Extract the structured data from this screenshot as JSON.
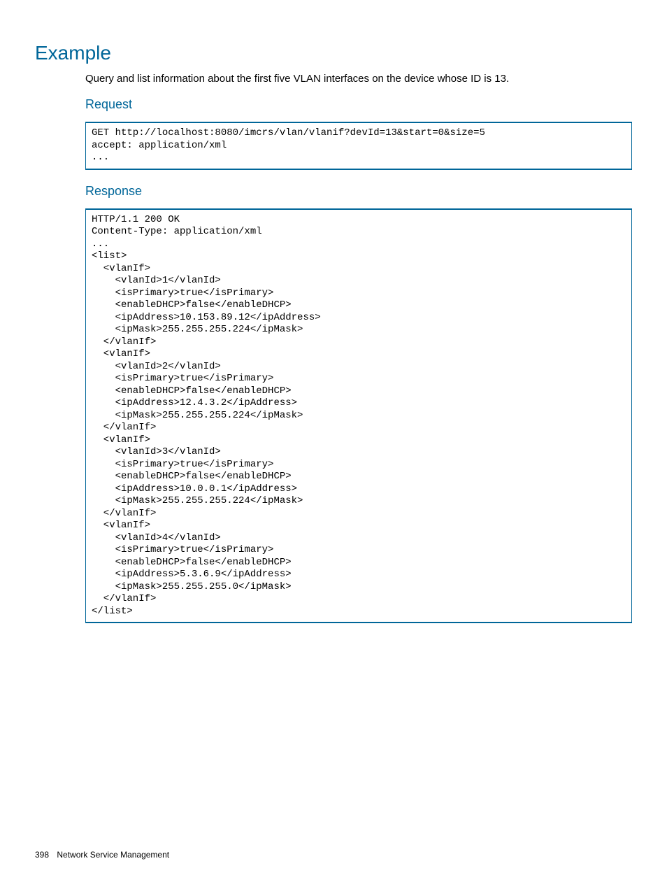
{
  "heading": "Example",
  "intro": "Query and list information about the first five VLAN interfaces on the device whose ID is 13.",
  "request_heading": "Request",
  "request_code": "GET http://localhost:8080/imcrs/vlan/vlanif?devId=13&start=0&size=5\naccept: application/xml\n...",
  "response_heading": "Response",
  "response_code": "HTTP/1.1 200 OK\nContent-Type: application/xml\n...\n<list>\n  <vlanIf>\n    <vlanId>1</vlanId>\n    <isPrimary>true</isPrimary>\n    <enableDHCP>false</enableDHCP>\n    <ipAddress>10.153.89.12</ipAddress>\n    <ipMask>255.255.255.224</ipMask>\n  </vlanIf>\n  <vlanIf>\n    <vlanId>2</vlanId>\n    <isPrimary>true</isPrimary>\n    <enableDHCP>false</enableDHCP>\n    <ipAddress>12.4.3.2</ipAddress>\n    <ipMask>255.255.255.224</ipMask>\n  </vlanIf>\n  <vlanIf>\n    <vlanId>3</vlanId>\n    <isPrimary>true</isPrimary>\n    <enableDHCP>false</enableDHCP>\n    <ipAddress>10.0.0.1</ipAddress>\n    <ipMask>255.255.255.224</ipMask>\n  </vlanIf>\n  <vlanIf>\n    <vlanId>4</vlanId>\n    <isPrimary>true</isPrimary>\n    <enableDHCP>false</enableDHCP>\n    <ipAddress>5.3.6.9</ipAddress>\n    <ipMask>255.255.255.0</ipMask>\n  </vlanIf>\n</list>",
  "footer_page": "398",
  "footer_title": "Network Service Management"
}
